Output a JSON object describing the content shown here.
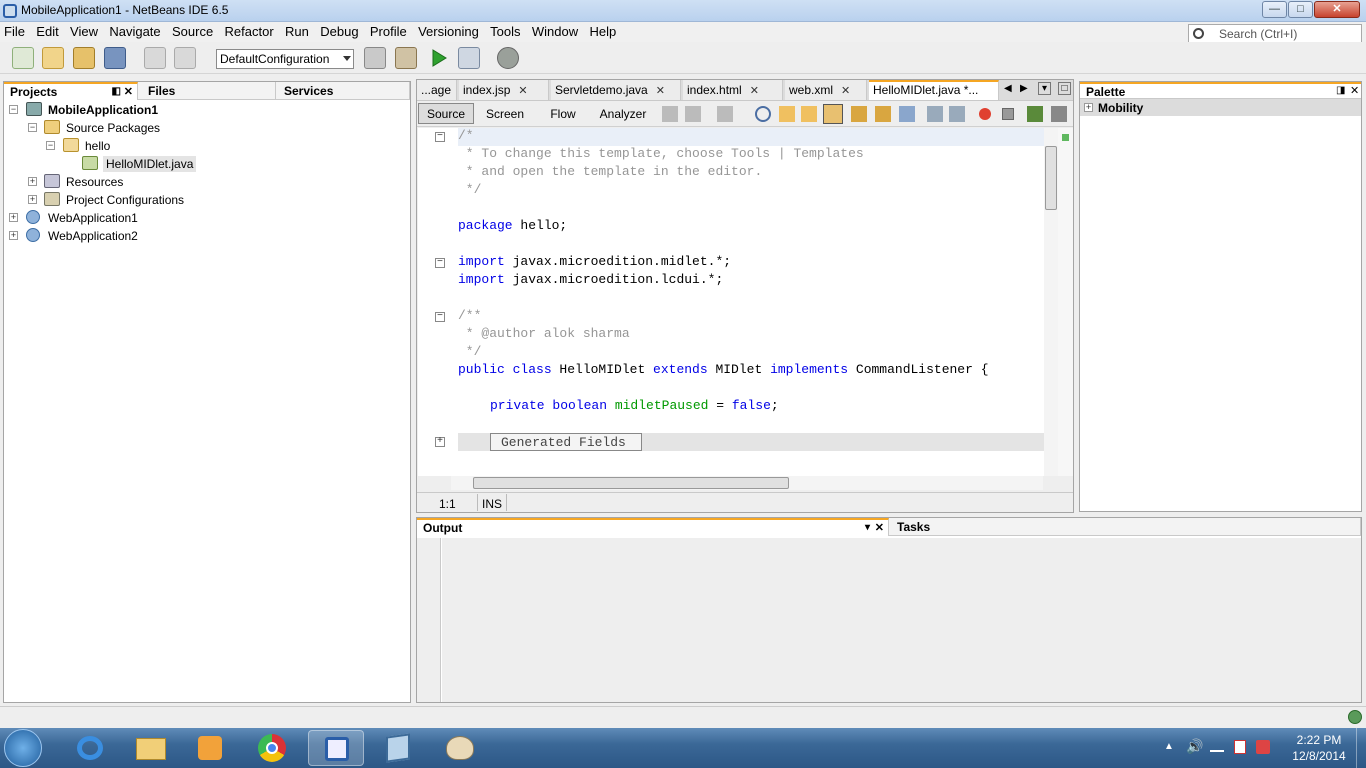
{
  "window": {
    "title": "MobileApplication1 - NetBeans IDE 6.5",
    "min": "—",
    "max": "□",
    "close": "✕"
  },
  "menu": [
    "File",
    "Edit",
    "View",
    "Navigate",
    "Source",
    "Refactor",
    "Run",
    "Debug",
    "Profile",
    "Versioning",
    "Tools",
    "Window",
    "Help"
  ],
  "toolbar": {
    "config": "DefaultConfiguration",
    "search_placeholder": "Search (Ctrl+I)"
  },
  "left_panel": {
    "tabs": [
      "Projects",
      "Files",
      "Services"
    ],
    "tree": [
      {
        "label": "MobileApplication1",
        "bold": true
      },
      {
        "label": "Source Packages"
      },
      {
        "label": "hello"
      },
      {
        "label": "HelloMIDlet.java"
      },
      {
        "label": "Resources"
      },
      {
        "label": "Project Configurations"
      },
      {
        "label": "WebApplication1"
      },
      {
        "label": "WebApplication2"
      }
    ]
  },
  "editor": {
    "tabs": [
      "...age",
      "index.jsp",
      "Servletdemo.java",
      "index.html",
      "web.xml",
      "HelloMIDlet.java *..."
    ],
    "view_tabs": [
      "Source",
      "Screen",
      "Flow",
      "Analyzer"
    ],
    "code": {
      "l1": "/*",
      "l2": " * To change this template, choose Tools | Templates",
      "l3": " * and open the template in the editor.",
      "l4": " */",
      "l6a": "package",
      "l6b": " hello;",
      "l8a": "import",
      "l8b": " javax.microedition.midlet.*;",
      "l9a": "import",
      "l9b": " javax.microedition.lcdui.*;",
      "l11": "/**",
      "l12": " * @author alok sharma",
      "l13": " */",
      "l14a": "public class",
      "l14b": " HelloMIDlet ",
      "l14c": "extends",
      "l14d": " MIDlet ",
      "l14e": "implements",
      "l14f": " CommandListener {",
      "l16a": "private boolean",
      "l16b": " midletPaused",
      "l16c": " = ",
      "l16d": "false",
      "l16e": ";",
      "generated": "Generated Fields"
    },
    "status": {
      "position": "1:1",
      "mode": "INS"
    }
  },
  "palette": {
    "title": "Palette",
    "category": "Mobility"
  },
  "output": {
    "tabs": [
      "Output",
      "Tasks"
    ]
  },
  "clock": {
    "time": "2:22 PM",
    "date": "12/8/2014"
  }
}
